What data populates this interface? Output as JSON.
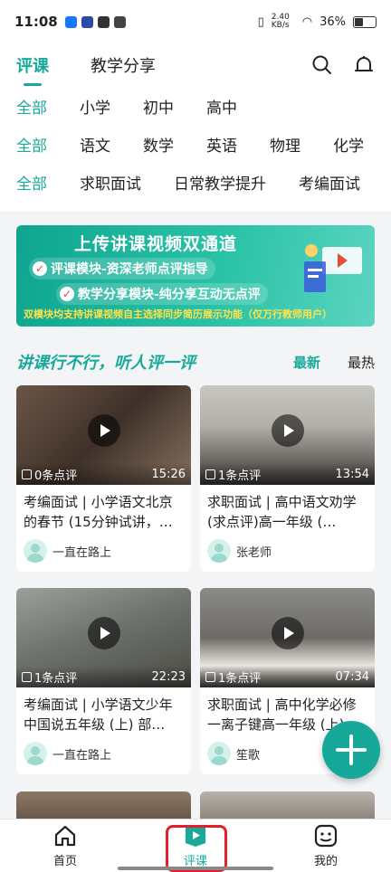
{
  "status": {
    "time": "11:08",
    "net_speed": "2.40 KB/s",
    "battery": "36%",
    "battery_level": 0.36
  },
  "top_tabs": [
    {
      "label": "评课",
      "active": true
    },
    {
      "label": "教学分享",
      "active": false
    }
  ],
  "filters": {
    "stage": [
      "全部",
      "小学",
      "初中",
      "高中"
    ],
    "subject": [
      "全部",
      "语文",
      "数学",
      "英语",
      "物理",
      "化学"
    ],
    "category": [
      "全部",
      "求职面试",
      "日常教学提升",
      "考编面试"
    ]
  },
  "banner": {
    "title": "上传讲课视频双通道",
    "line1": "评课模块-资深老师点评指导",
    "line2": "教学分享模块-纯分享互动无点评",
    "footnote": "双模块均支持讲课视频自主选择同步简历展示功能（仅万行教师用户）"
  },
  "section": {
    "title": "讲课行不行，听人评一评",
    "sort_latest": "最新",
    "sort_hot": "最热"
  },
  "cards": [
    {
      "comments": "0条点评",
      "duration": "15:26",
      "title": "考编面试 | 小学语文北京的春节 (15分钟试讲，…",
      "author": "一直在路上"
    },
    {
      "comments": "1条点评",
      "duration": "13:54",
      "title": "求职面试 | 高中语文劝学(求点评)高一年级 (…",
      "author": "张老师"
    },
    {
      "comments": "1条点评",
      "duration": "22:23",
      "title": "考编面试 | 小学语文少年中国说五年级 (上) 部…",
      "author": "一直在路上"
    },
    {
      "comments": "1条点评",
      "duration": "07:34",
      "title": "求职面试 | 高中化学必修一离子键高一年级 (上)…",
      "author": "笙歌"
    }
  ],
  "bottom_nav": [
    {
      "label": "首页"
    },
    {
      "label": "评课"
    },
    {
      "label": "我的"
    }
  ],
  "colors": {
    "accent": "#17a99a",
    "highlight": "#e0202a"
  }
}
